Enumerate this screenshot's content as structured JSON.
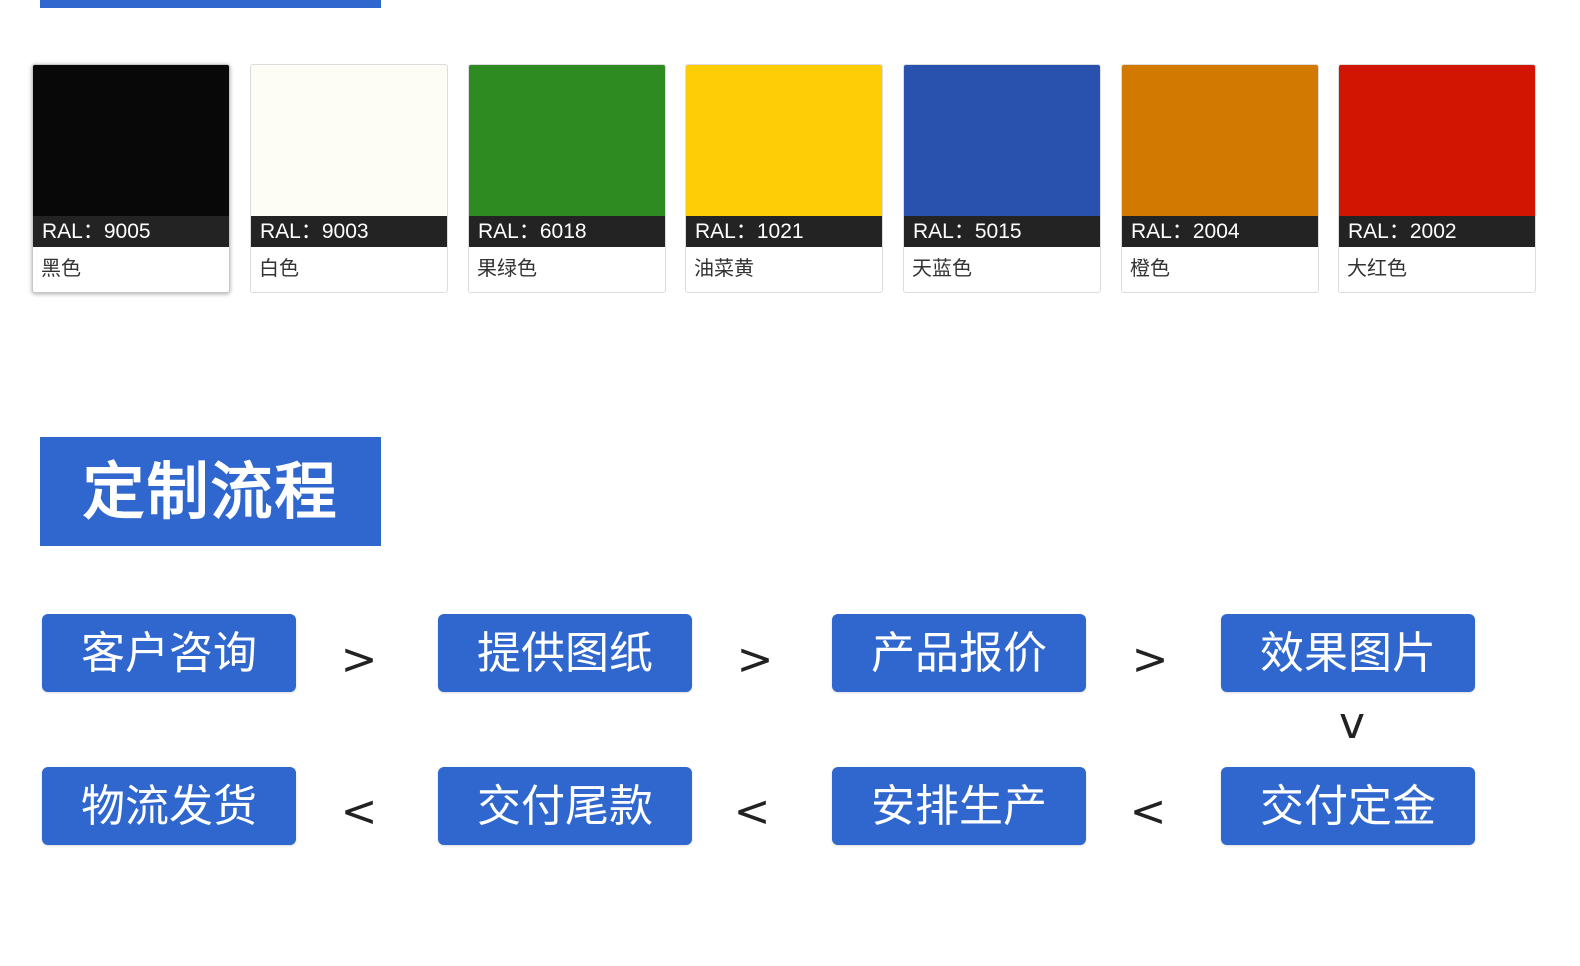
{
  "colors": {
    "brand_blue": "#2f67cf",
    "label_bar": "#232323"
  },
  "swatches": [
    {
      "code": "RAL：9005",
      "name": "黑色",
      "color": "#080808"
    },
    {
      "code": "RAL：9003",
      "name": "白色",
      "color": "#fefdf5"
    },
    {
      "code": "RAL：6018",
      "name": "果绿色",
      "color": "#2d8b22"
    },
    {
      "code": "RAL：1021",
      "name": "油菜黄",
      "color": "#fecd06"
    },
    {
      "code": "RAL：5015",
      "name": "天蓝色",
      "color": "#2952af"
    },
    {
      "code": "RAL：2004",
      "name": "橙色",
      "color": "#d27902"
    },
    {
      "code": "RAL：2002",
      "name": "大红色",
      "color": "#d11502"
    }
  ],
  "process": {
    "title": "定制流程",
    "steps": [
      "客户咨询",
      "提供图纸",
      "产品报价",
      "效果图片",
      "交付定金",
      "安排生产",
      "交付尾款",
      "物流发货"
    ],
    "arrows": {
      "right": ">",
      "left": "<",
      "down": "v"
    }
  }
}
